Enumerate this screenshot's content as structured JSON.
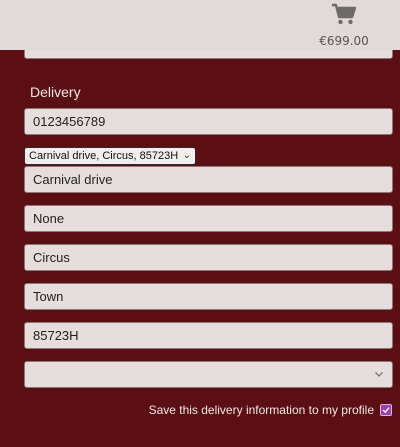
{
  "header": {
    "cart_icon": "cart-icon",
    "cart_total": "€699.00"
  },
  "form": {
    "email_value": "..............@.........",
    "delivery_label": "Delivery",
    "phone": "0123456789",
    "saved_address": "Carnival drive, Circus, 85723H",
    "street_address1": "Carnival drive",
    "street_address2": "None",
    "town_or_city": "Circus",
    "county": "Town",
    "postcode": "85723H",
    "country": "",
    "save_label": "Save this delivery information to my profile",
    "save_checked": true
  },
  "colors": {
    "background": "#5b0f12",
    "header": "#e2d9d9",
    "checkbox": "#9c3db0"
  }
}
